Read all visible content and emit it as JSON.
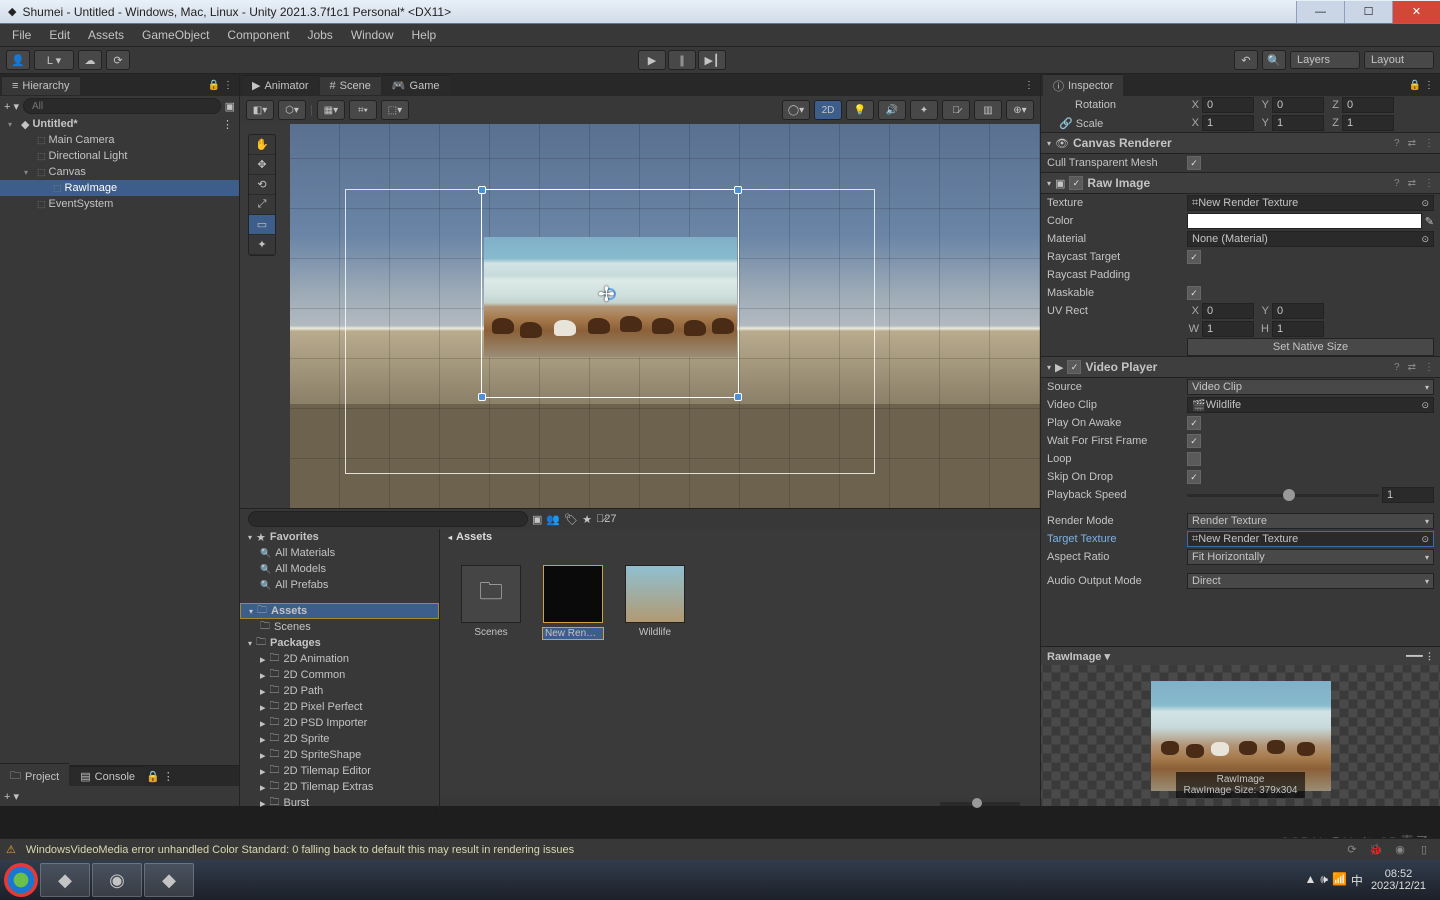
{
  "window": {
    "title": "Shumei - Untitled - Windows, Mac, Linux - Unity 2021.3.7f1c1 Personal* <DX11>"
  },
  "menubar": [
    "File",
    "Edit",
    "Assets",
    "GameObject",
    "Component",
    "Jobs",
    "Window",
    "Help"
  ],
  "topstrip": {
    "account": "L ▾",
    "layers": "Layers",
    "layout": "Layout"
  },
  "hierarchy": {
    "tab": "Hierarchy",
    "search": "All",
    "items": [
      {
        "depth": 0,
        "expand": true,
        "label": "Untitled*",
        "unity": true
      },
      {
        "depth": 1,
        "label": "Main Camera"
      },
      {
        "depth": 1,
        "label": "Directional Light"
      },
      {
        "depth": 1,
        "expand": true,
        "label": "Canvas"
      },
      {
        "depth": 2,
        "label": "RawImage",
        "sel": true
      },
      {
        "depth": 1,
        "label": "EventSystem"
      }
    ]
  },
  "scene_tabs": {
    "animator": "Animator",
    "scene": "Scene",
    "game": "Game"
  },
  "scene_toolbar": {
    "twod": "2D"
  },
  "project": {
    "tab_project": "Project",
    "tab_console": "Console",
    "hidden_count": "27",
    "fav": "Favorites",
    "favs": [
      "All Materials",
      "All Models",
      "All Prefabs"
    ],
    "assets": "Assets",
    "scenes": "Scenes",
    "packages": "Packages",
    "pkg": [
      "2D Animation",
      "2D Common",
      "2D Path",
      "2D Pixel Perfect",
      "2D PSD Importer",
      "2D Sprite",
      "2D SpriteShape",
      "2D Tilemap Editor",
      "2D Tilemap Extras",
      "Burst"
    ],
    "bread": "Assets",
    "items": [
      {
        "name": "Scenes",
        "type": "folder"
      },
      {
        "name": "New Rend…",
        "type": "rt"
      },
      {
        "name": "Wildlife",
        "type": "vid"
      }
    ]
  },
  "inspector": {
    "tab": "Inspector",
    "transform": {
      "rotation": "Rotation",
      "scale": "Scale",
      "rx": "0",
      "ry": "0",
      "rz": "0",
      "sx": "1",
      "sy": "1",
      "sz": "1"
    },
    "canvas_renderer": {
      "title": "Canvas Renderer",
      "cull_label": "Cull Transparent Mesh",
      "cull": true
    },
    "raw_image": {
      "title": "Raw Image",
      "texture_label": "Texture",
      "texture": "New Render Texture",
      "color_label": "Color",
      "material_label": "Material",
      "material": "None (Material)",
      "raycast_target_label": "Raycast Target",
      "raycast_target": true,
      "raycast_padding_label": "Raycast Padding",
      "maskable_label": "Maskable",
      "maskable": true,
      "uvrect_label": "UV Rect",
      "uv_x": "0",
      "uv_y": "0",
      "uv_w": "1",
      "uv_h": "1",
      "native_btn": "Set Native Size"
    },
    "video_player": {
      "title": "Video Player",
      "source_label": "Source",
      "source": "Video Clip",
      "clip_label": "Video Clip",
      "clip": "Wildlife",
      "play_on_awake_label": "Play On Awake",
      "play_on_awake": true,
      "wait_label": "Wait For First Frame",
      "wait": true,
      "loop_label": "Loop",
      "loop": false,
      "skip_label": "Skip On Drop",
      "skip": true,
      "speed_label": "Playback Speed",
      "speed": "1",
      "render_mode_label": "Render Mode",
      "render_mode": "Render Texture",
      "target_texture_label": "Target Texture",
      "target_texture": "New Render Texture",
      "aspect_label": "Aspect Ratio",
      "aspect": "Fit Horizontally",
      "audio_label": "Audio Output Mode",
      "audio": "Direct"
    },
    "preview": {
      "title": "RawImage ▾",
      "caption": "RawImage",
      "size": "RawImage Size: 379x304"
    }
  },
  "status": {
    "msg": "WindowsVideoMedia error unhandled Color Standard: 0  falling back to default this may result in rendering issues"
  },
  "taskbar": {
    "time": "08:52",
    "date": "2023/12/21"
  },
  "watermark": "CSDN @Unity3D青子"
}
